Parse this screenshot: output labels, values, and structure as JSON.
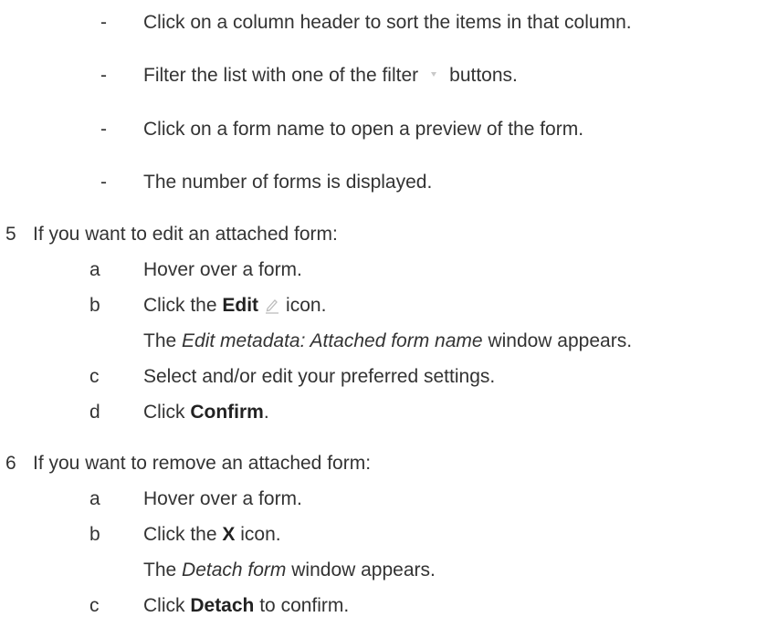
{
  "bullets": [
    {
      "dash": "-",
      "text": "Click on a column header to sort the items in that column."
    },
    {
      "dash": "-",
      "text_before": "Filter the list with one of the filter",
      "icon": "filter-icon",
      "text_after": "buttons."
    },
    {
      "dash": "-",
      "text": "Click on a form name to open a preview of the form."
    },
    {
      "dash": "-",
      "text": "The number of forms is displayed."
    }
  ],
  "step5": {
    "num": "5",
    "text": "If you want to edit an attached form:",
    "items": [
      {
        "letter": "a",
        "text": "Hover over a form."
      },
      {
        "letter": "b",
        "before": "Click the",
        "bold": "Edit",
        "icon": "pencil-icon",
        "after": "icon.",
        "note_italic": "Edit metadata: Attached form name",
        "note_before": "The",
        "note_after": "window appears."
      },
      {
        "letter": "c",
        "text": "Select and/or edit your preferred settings."
      },
      {
        "letter": "d",
        "before": "Click",
        "bold": "Confirm",
        "after": "."
      }
    ]
  },
  "step6": {
    "num": "6",
    "text": "If you want to remove an attached form:",
    "items": [
      {
        "letter": "a",
        "text": "Hover over a form."
      },
      {
        "letter": "b",
        "before": "Click the",
        "bold": "X",
        "after": "icon.",
        "note_before": "The",
        "note_italic": "Detach form",
        "note_after": "window appears."
      },
      {
        "letter": "c",
        "before": "Click",
        "bold": "Detach",
        "after": "to confirm."
      }
    ]
  }
}
